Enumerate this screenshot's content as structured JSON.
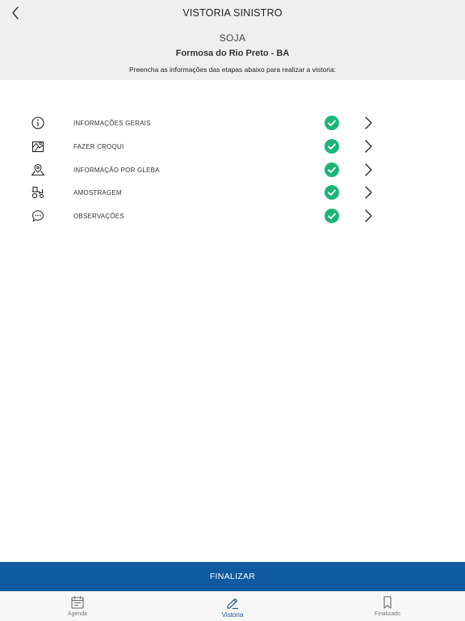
{
  "header": {
    "title": "VISTORIA SINISTRO",
    "crop": "SOJA",
    "location": "Formosa do Rio Preto - BA",
    "instruction": "Preencha as informações das etapas abaixo para realizar a vistoria:"
  },
  "steps": [
    {
      "label": "INFORMAÇÕES GERAIS",
      "icon": "info-icon",
      "status": "complete"
    },
    {
      "label": "FAZER CROQUI",
      "icon": "map-sketch-icon",
      "status": "complete"
    },
    {
      "label": "INFORMAÇÃO POR GLEBA",
      "icon": "map-pin-icon",
      "status": "complete"
    },
    {
      "label": "AMOSTRAGEM",
      "icon": "tractor-icon",
      "status": "complete"
    },
    {
      "label": "OBSERVAÇÕES",
      "icon": "chat-bubble-icon",
      "status": "complete"
    }
  ],
  "finalize_label": "FINALIZAR",
  "tabs": [
    {
      "label": "Agenda",
      "icon": "calendar-icon",
      "active": false
    },
    {
      "label": "Vistoria",
      "icon": "pencil-icon",
      "active": true
    },
    {
      "label": "Finalizado",
      "icon": "bookmark-icon",
      "active": false
    }
  ],
  "colors": {
    "header_bg": "#efefef",
    "check_green": "#1bb57a",
    "primary_blue": "#0f5aa0",
    "active_tab": "#1a5a94"
  }
}
